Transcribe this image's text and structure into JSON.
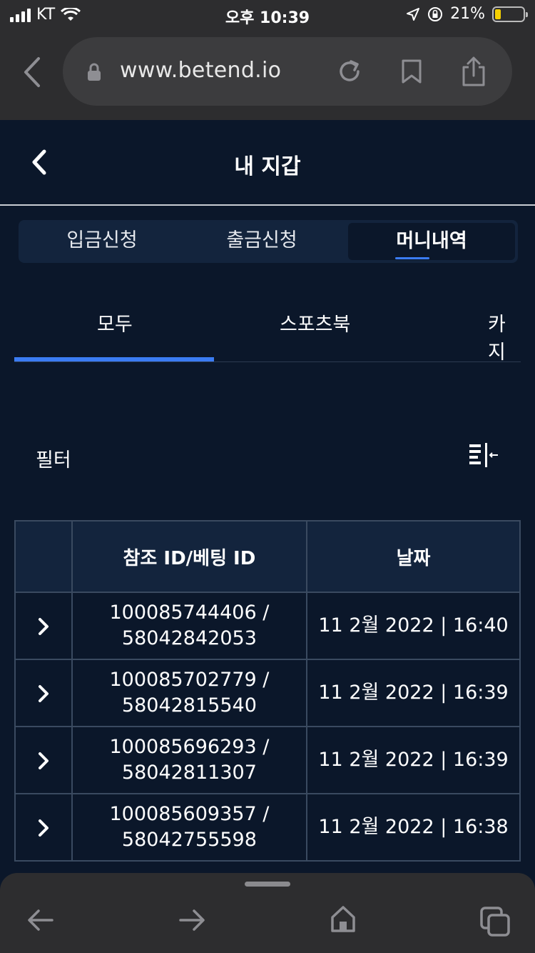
{
  "status_bar": {
    "carrier": "KT",
    "time": "오후 10:39",
    "battery_percent": "21%",
    "battery_level": 0.21,
    "battery_color": "#f5d000"
  },
  "browser": {
    "url": "www.betend.io",
    "icons": [
      "back-arrow-icon",
      "lock-icon",
      "reload-icon",
      "bookmark-icon",
      "share-icon",
      "chevron-left-icon",
      "chevron-right-icon",
      "home-icon",
      "tabs-icon"
    ]
  },
  "header": {
    "title": "내 지갑"
  },
  "segmented_tabs": [
    {
      "label": "입금신청",
      "active": false
    },
    {
      "label": "출금신청",
      "active": false
    },
    {
      "label": "머니내역",
      "active": true
    }
  ],
  "sub_tabs": [
    {
      "label": "모두",
      "active": true
    },
    {
      "label": "스포츠북",
      "active": false
    },
    {
      "label": "카지",
      "active": false
    }
  ],
  "filter": {
    "label": "필터"
  },
  "table": {
    "headers": [
      "",
      "참조 ID/베팅 ID",
      "날짜"
    ],
    "rows": [
      {
        "ref_id": "100085744406 /",
        "bet_id": "58042842053",
        "date": "11 2월 2022 | 16:40"
      },
      {
        "ref_id": "100085702779 /",
        "bet_id": "58042815540",
        "date": "11 2월 2022 | 16:39"
      },
      {
        "ref_id": "100085696293 /",
        "bet_id": "58042811307",
        "date": "11 2월 2022 | 16:39"
      },
      {
        "ref_id": "100085609357 /",
        "bet_id": "58042755598",
        "date": "11 2월 2022 | 16:38"
      }
    ]
  },
  "colors": {
    "page_bg": "#0b172a",
    "accent": "#3b7cf3",
    "header_bg": "#13243d",
    "browser_bg": "#2d2d2f"
  }
}
